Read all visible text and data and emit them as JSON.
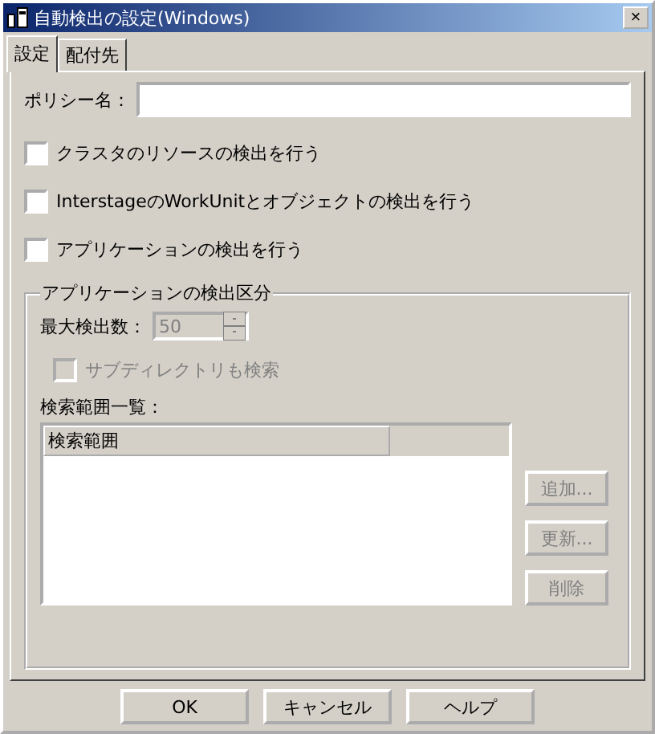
{
  "window": {
    "title": "自動検出の設定(Windows)",
    "close": "×"
  },
  "tabs": [
    {
      "label": "設定",
      "selected": true
    },
    {
      "label": "配付先",
      "selected": false
    }
  ],
  "policy_name": {
    "label": "ポリシー名："
  },
  "options": [
    {
      "label": "クラスタのリソースの検出を行う",
      "checked": false
    },
    {
      "label": "InterstageのWorkUnitとオブジェクトの検出を行う",
      "checked": false
    },
    {
      "label": "アプリケーションの検出を行う",
      "checked": false
    }
  ],
  "app_group": {
    "title": "アプリケーションの検出区分",
    "max_count": {
      "label": "最大検出数：",
      "value": "50",
      "disabled": true
    },
    "subdirectory": {
      "label": "サブディレクトリも検索",
      "checked": false,
      "disabled": true
    },
    "list_label": "検索範囲一覧：",
    "columns": [
      "検索範囲"
    ],
    "buttons": [
      {
        "label": "追加...",
        "disabled": true
      },
      {
        "label": "更新...",
        "disabled": true
      },
      {
        "label": "削除",
        "disabled": true
      }
    ]
  },
  "buttons": [
    "OK",
    "キャンセル",
    "ヘルプ"
  ]
}
